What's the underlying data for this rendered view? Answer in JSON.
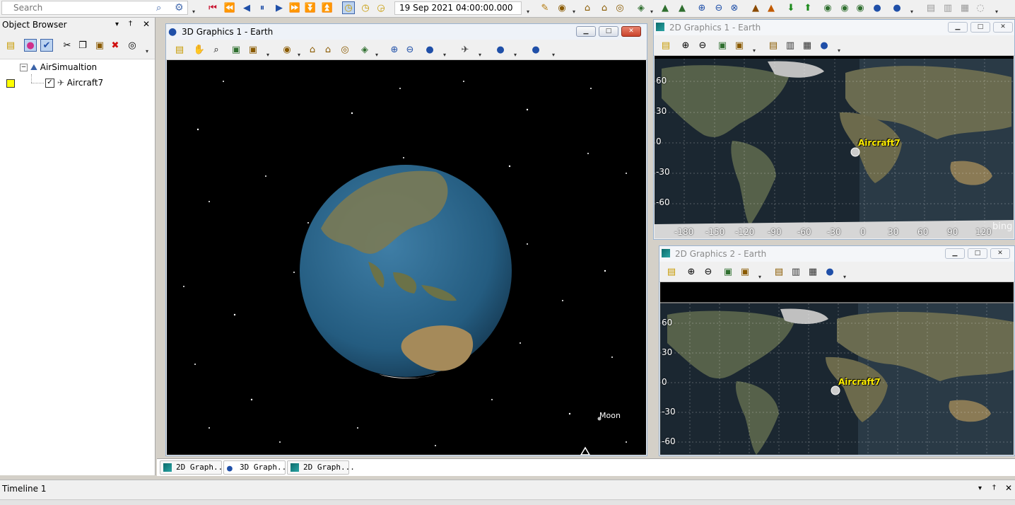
{
  "toolbar": {
    "search_placeholder": "Search",
    "datetime": "19 Sep 2021 04:00:00.000"
  },
  "object_browser": {
    "title": "Object Browser",
    "tree": {
      "scenario": "AirSimualtion",
      "child": "Aircraft7"
    }
  },
  "windows": {
    "win3d": {
      "title": "3D Graphics 1 - Earth",
      "moon_label": "Moon"
    },
    "win2d1": {
      "title": "2D Graphics 1 - Earth",
      "lat_labels": [
        "60",
        "30",
        "0",
        "-30",
        "-60"
      ],
      "lon_labels": [
        "-180",
        "-150",
        "-120",
        "-90",
        "-60",
        "-30",
        "0",
        "30",
        "60",
        "90",
        "120"
      ],
      "aircraft_label": "Aircraft7",
      "watermark": "bing"
    },
    "win2d2": {
      "title": "2D Graphics 2 - Earth",
      "lat_labels": [
        "60",
        "30",
        "0",
        "-30",
        "-60"
      ],
      "aircraft_label": "Aircraft7"
    }
  },
  "tabs": [
    {
      "label": "2D Graph..."
    },
    {
      "label": "3D Graph..."
    },
    {
      "label": "2D Graph..."
    }
  ],
  "timeline": {
    "title": "Timeline 1"
  },
  "colors": {
    "accent_blue": "#1f4fa8",
    "play_red": "#c8102e",
    "aircraft_label": "#ffee00",
    "highlight": "#ffff00"
  }
}
